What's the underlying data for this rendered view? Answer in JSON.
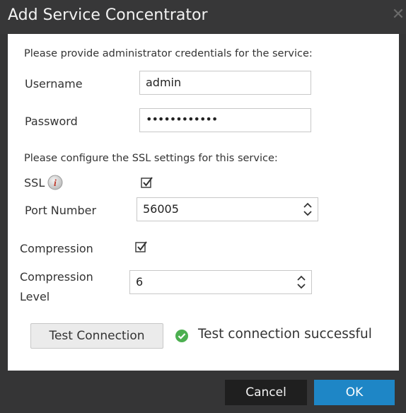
{
  "dialog": {
    "title": "Add Service Concentrator",
    "close_icon": "close-icon"
  },
  "credentials": {
    "prompt": "Please provide administrator credentials for the service:",
    "username_label": "Username",
    "username_value": "admin",
    "password_label": "Password",
    "password_value": "••••••••••••"
  },
  "ssl": {
    "prompt": "Please configure the SSL settings for this service:",
    "ssl_label": "SSL",
    "ssl_checked": true,
    "info_icon": "info-icon",
    "port_label": "Port Number",
    "port_value": "56005"
  },
  "compression": {
    "label": "Compression",
    "checked": true,
    "level_label_line1": "Compression",
    "level_label_line2": "Level",
    "level_value": "6"
  },
  "test": {
    "button_label": "Test Connection",
    "status_text": "Test connection successful",
    "status_icon": "check-circle-icon"
  },
  "footer": {
    "cancel_label": "Cancel",
    "ok_label": "OK"
  },
  "colors": {
    "dialog_bg": "#353536",
    "body_bg": "#ffffff",
    "ok_bg": "#1e86c6",
    "cancel_bg": "#1f1f1f",
    "success": "#4caf50"
  }
}
